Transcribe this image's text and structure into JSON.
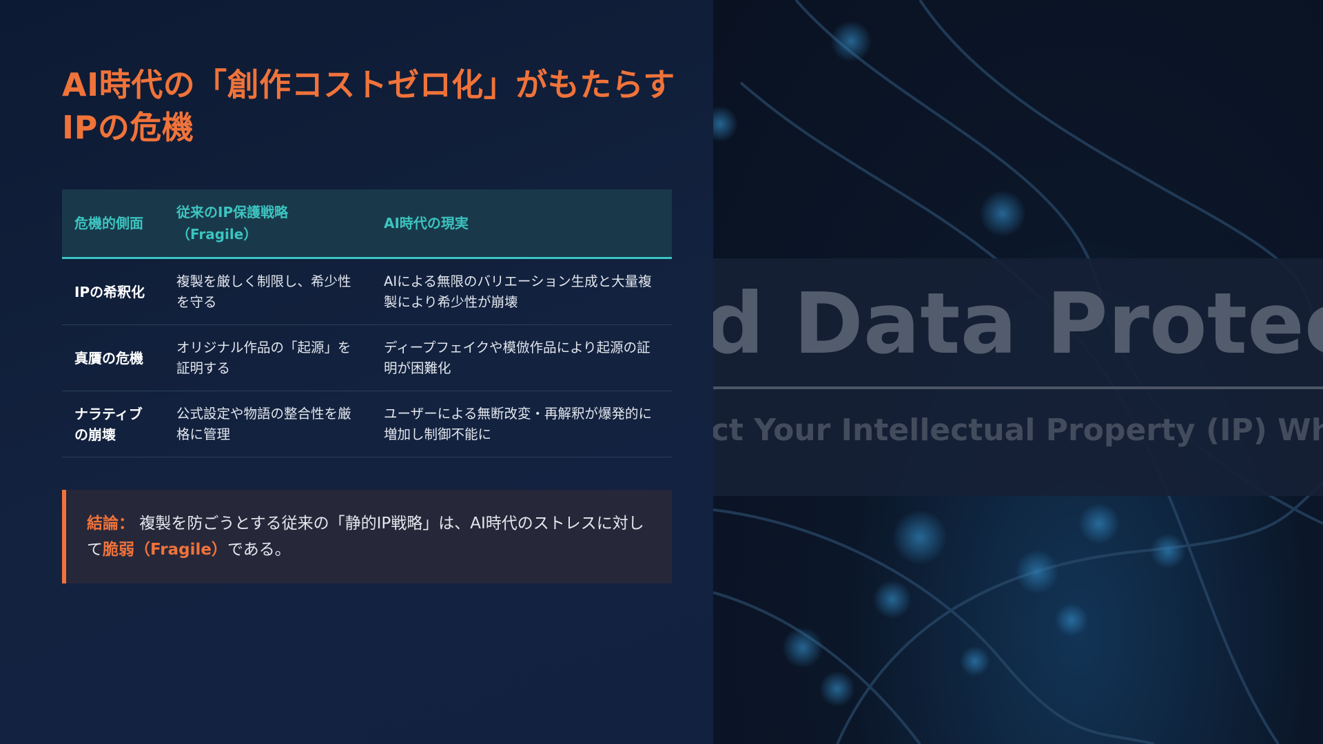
{
  "slide": {
    "title": "AI時代の「創作コストゼロ化」がもたらすIPの危機",
    "table": {
      "headers": [
        "危機的側面",
        "従来のIP保護戦略（Fragile）",
        "AI時代の現実"
      ],
      "rows": [
        {
          "aspect": "IPの希釈化",
          "traditional": "複製を厳しく制限し、希少性を守る",
          "reality": "AIによる無限のバリエーション生成と大量複製により希少性が崩壊"
        },
        {
          "aspect": "真贋の危機",
          "traditional": "オリジナル作品の「起源」を証明する",
          "reality": "ディープフェイクや模倣作品により起源の証明が困難化"
        },
        {
          "aspect": "ナラティブの崩壊",
          "traditional": "公式設定や物語の整合性を厳格に管理",
          "reality": "ユーザーによる無断改変・再解釈が爆発的に増加し制御不能に"
        }
      ]
    },
    "conclusion": {
      "label": "結論：",
      "text_before": "複製を防ごうとする従来の「静的IP戦略」は、AI時代のストレスに対して",
      "emphasis": "脆弱（Fragile）",
      "text_after": "である。"
    }
  },
  "background_image": {
    "title_fragment": "nd Data Protec",
    "subtitle_fragment": "ect Your Intellectual Property (IP) Wh"
  },
  "colors": {
    "accent_orange": "#f0733a",
    "header_teal": "#3cc4c0",
    "background_navy": "#0f1a31"
  }
}
